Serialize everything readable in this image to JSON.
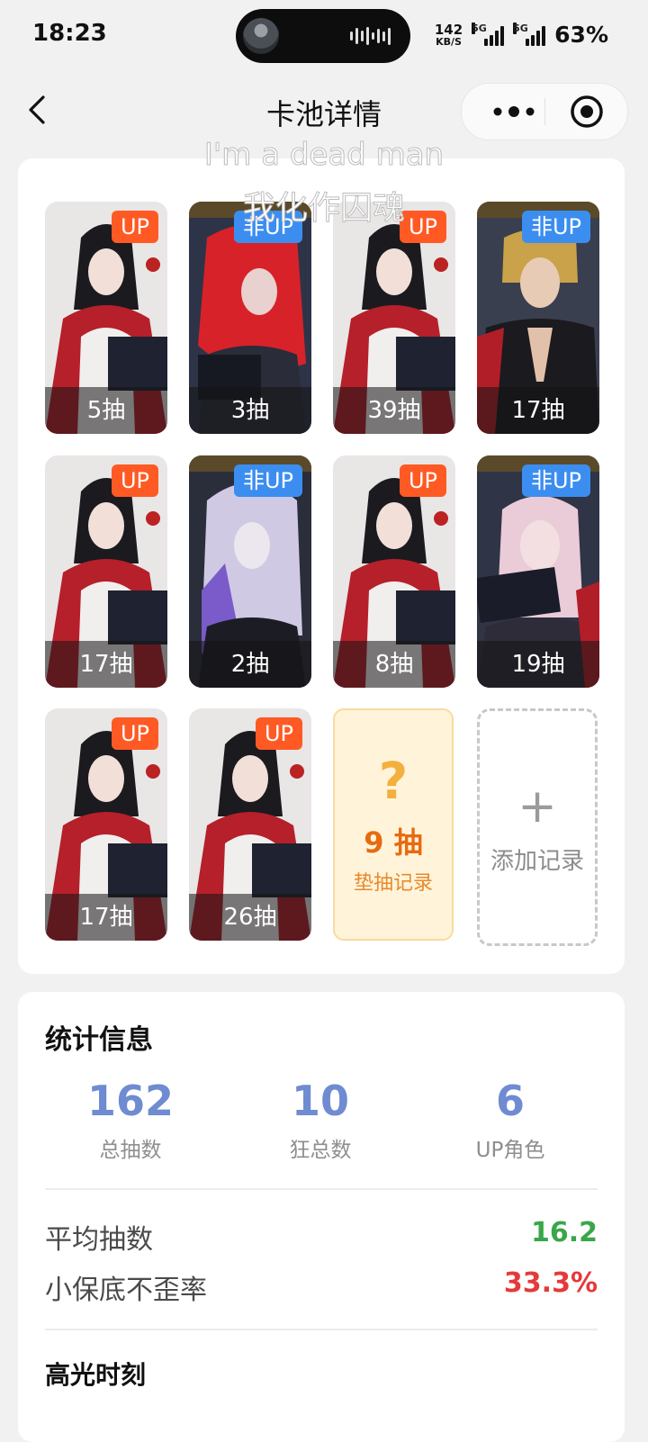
{
  "status": {
    "time": "18:23",
    "speed_value": "142",
    "speed_unit": "KB/S",
    "sim1": "5G",
    "sim2": "5G",
    "battery": "63%"
  },
  "nav": {
    "title": "卡池详情"
  },
  "subtitle": {
    "line1": "I'm a dead man",
    "line2": "我化作囚魂"
  },
  "cards": [
    {
      "badge": "UP",
      "pulls": "5抽",
      "type": "up"
    },
    {
      "badge": "非UP",
      "pulls": "3抽",
      "type": "nonup"
    },
    {
      "badge": "UP",
      "pulls": "39抽",
      "type": "up"
    },
    {
      "badge": "非UP",
      "pulls": "17抽",
      "type": "nonup"
    },
    {
      "badge": "UP",
      "pulls": "17抽",
      "type": "up"
    },
    {
      "badge": "非UP",
      "pulls": "2抽",
      "type": "nonup"
    },
    {
      "badge": "UP",
      "pulls": "8抽",
      "type": "up"
    },
    {
      "badge": "非UP",
      "pulls": "19抽",
      "type": "nonup"
    },
    {
      "badge": "UP",
      "pulls": "17抽",
      "type": "up"
    },
    {
      "badge": "UP",
      "pulls": "26抽",
      "type": "up"
    }
  ],
  "pity": {
    "symbol": "?",
    "count": "9 抽",
    "label": "垫抽记录"
  },
  "add_record": {
    "symbol": "+",
    "label": "添加记录"
  },
  "stats": {
    "title": "统计信息",
    "items": [
      {
        "value": "162",
        "label": "总抽数"
      },
      {
        "value": "10",
        "label": "狂总数"
      },
      {
        "value": "6",
        "label": "UP角色"
      }
    ],
    "avg_label": "平均抽数",
    "avg_value": "16.2",
    "win_label": "小保底不歪率",
    "win_value": "33.3%",
    "highlight_title": "高光时刻"
  },
  "colors": {
    "up_badge": "#ff5a24",
    "nonup_badge": "#3b8ef0",
    "stat_blue": "#6f8bd1",
    "avg_green": "#3aa64a",
    "rate_red": "#e5393a"
  }
}
